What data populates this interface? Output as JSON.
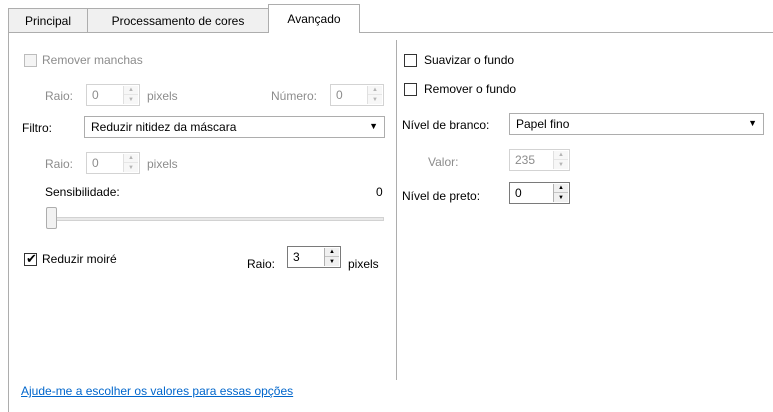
{
  "tabs": [
    "Principal",
    "Processamento de cores",
    "Avançado"
  ],
  "left": {
    "remove_spots": {
      "label": "Remover manchas",
      "checked": false,
      "enabled": false
    },
    "radius1": {
      "label": "Raio:",
      "value": "0",
      "unit": "pixels"
    },
    "number": {
      "label": "Número:",
      "value": "0"
    },
    "filter": {
      "label": "Filtro:",
      "value": "Reduzir nitidez da máscara"
    },
    "radius2": {
      "label": "Raio:",
      "value": "0",
      "unit": "pixels"
    },
    "sensitivity": {
      "label": "Sensibilidade:",
      "value": "0"
    },
    "moire": {
      "label": "Reduzir moiré",
      "checked": true
    },
    "moire_radius": {
      "label": "Raio:",
      "value": "3",
      "unit": "pixels"
    }
  },
  "right": {
    "smooth_bg": {
      "label": "Suavizar o fundo",
      "checked": false
    },
    "remove_bg": {
      "label": "Remover o fundo",
      "checked": false
    },
    "white_level": {
      "label": "Nível de branco:",
      "value": "Papel fino"
    },
    "value": {
      "label": "Valor:",
      "value": "235"
    },
    "black_level": {
      "label": "Nível de preto:",
      "value": "0"
    }
  },
  "help_link": "Ajude-me a escolher os valores para essas opções",
  "icons": {
    "check": "✔",
    "up": "▲",
    "down": "▼"
  }
}
